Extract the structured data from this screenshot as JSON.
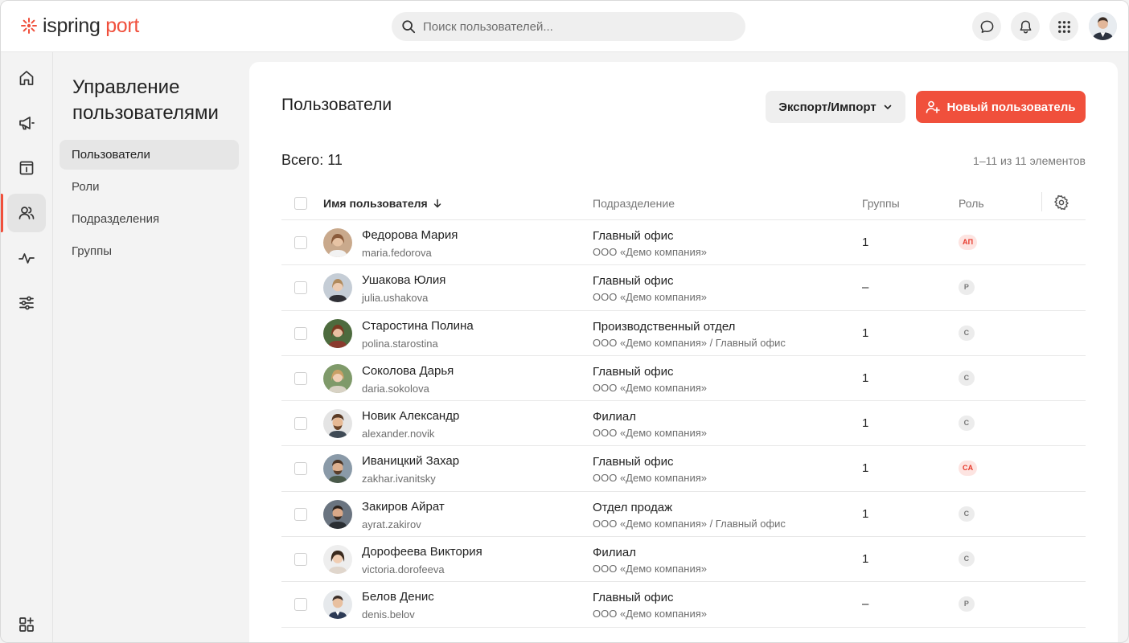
{
  "app": {
    "logo_primary": "ispring",
    "logo_secondary": "port",
    "brand_color": "#f0503c"
  },
  "search": {
    "placeholder": "Поиск пользователей..."
  },
  "topbar": {
    "icons": [
      "chat-icon",
      "bell-icon",
      "apps-grid-icon"
    ]
  },
  "rail": {
    "items": [
      "home-icon",
      "megaphone-icon",
      "info-calendar-icon",
      "users-icon",
      "activity-icon",
      "sliders-icon",
      "add-widget-icon"
    ],
    "active": "users-icon"
  },
  "subnav": {
    "title": "Управление пользователями",
    "items": [
      {
        "label": "Пользователи",
        "active": true
      },
      {
        "label": "Роли"
      },
      {
        "label": "Подразделения"
      },
      {
        "label": "Группы"
      }
    ]
  },
  "main": {
    "title": "Пользователи",
    "export_label": "Экспорт/Импорт",
    "new_user_label": "Новый пользователь",
    "total_label": "Всего:",
    "total_count": "11",
    "range": "1–11 из 11 элементов"
  },
  "table": {
    "headers": {
      "name": "Имя пользователя",
      "department": "Подразделение",
      "groups": "Группы",
      "role": "Роль"
    },
    "rows": [
      {
        "name": "Федорова Мария",
        "login": "maria.fedorova",
        "dept": "Главный офис",
        "path": "ООО «Демо компания»",
        "groups": "1",
        "role": "АП",
        "role_type": "red"
      },
      {
        "name": "Ушакова Юлия",
        "login": "julia.ushakova",
        "dept": "Главный офис",
        "path": "ООО «Демо компания»",
        "groups": "–",
        "role": "Р",
        "role_type": "grey"
      },
      {
        "name": "Старостина Полина",
        "login": "polina.starostina",
        "dept": "Производственный отдел",
        "path": "ООО «Демо компания» / Главный офис",
        "groups": "1",
        "role": "С",
        "role_type": "grey"
      },
      {
        "name": "Соколова Дарья",
        "login": "daria.sokolova",
        "dept": "Главный офис",
        "path": "ООО «Демо компания»",
        "groups": "1",
        "role": "С",
        "role_type": "grey"
      },
      {
        "name": "Новик Александр",
        "login": "alexander.novik",
        "dept": "Филиал",
        "path": "ООО «Демо компания»",
        "groups": "1",
        "role": "С",
        "role_type": "grey"
      },
      {
        "name": "Иваницкий Захар",
        "login": "zakhar.ivanitsky",
        "dept": "Главный офис",
        "path": "ООО «Демо компания»",
        "groups": "1",
        "role": "СА",
        "role_type": "red"
      },
      {
        "name": "Закиров Айрат",
        "login": "ayrat.zakirov",
        "dept": "Отдел продаж",
        "path": "ООО «Демо компания» / Главный офис",
        "groups": "1",
        "role": "С",
        "role_type": "grey"
      },
      {
        "name": "Дорофеева Виктория",
        "login": "victoria.dorofeeva",
        "dept": "Филиал",
        "path": "ООО «Демо компания»",
        "groups": "1",
        "role": "С",
        "role_type": "grey"
      },
      {
        "name": "Белов Денис",
        "login": "denis.belov",
        "dept": "Главный офис",
        "path": "ООО «Демо компания»",
        "groups": "–",
        "role": "Р",
        "role_type": "grey"
      }
    ]
  }
}
